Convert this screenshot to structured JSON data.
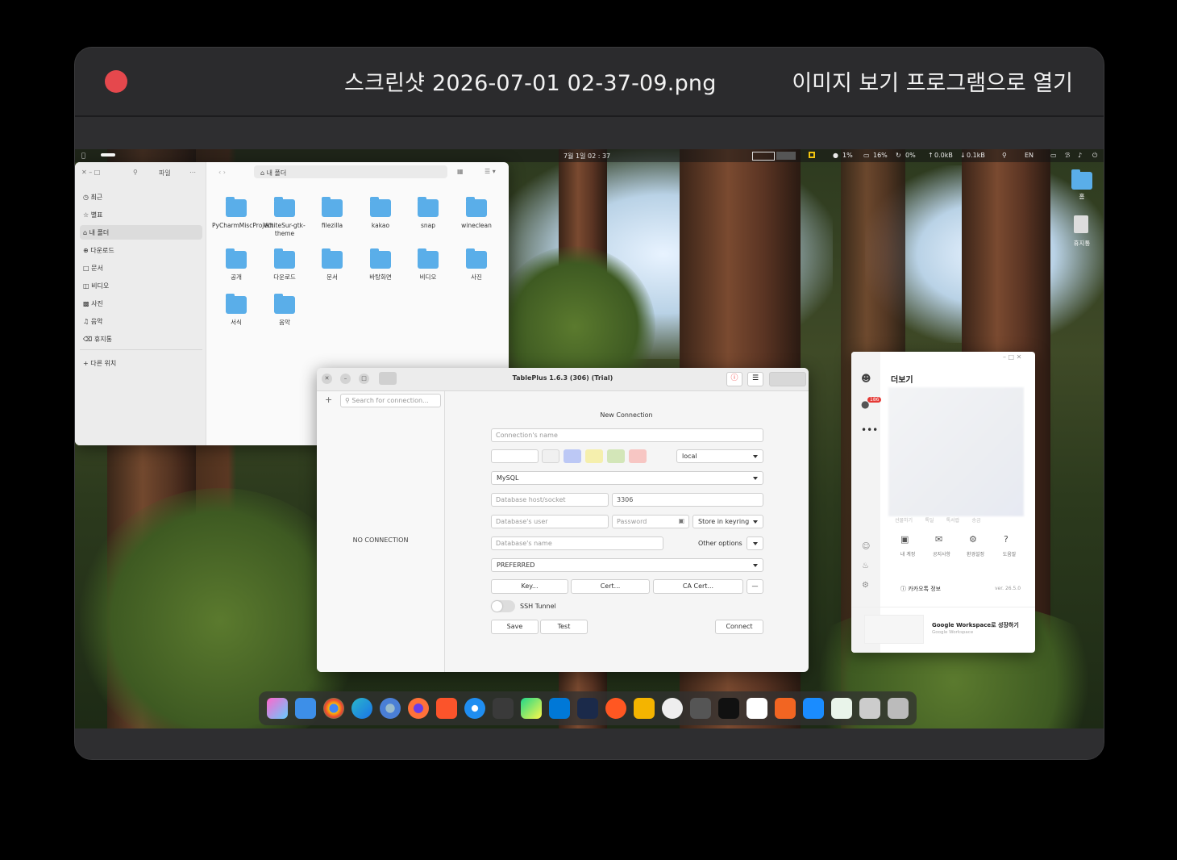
{
  "viewer": {
    "title": "스크린샷 2026-07-01 02-37-09.png",
    "open_with": "이미지 보기 프로그램으로 열기"
  },
  "topbar": {
    "clock": "7월 1일  02 : 37",
    "cpu": "1%",
    "battery": "16%",
    "net": "0%",
    "upload": "0.0kB",
    "download": "0.1kB",
    "lang": "EN"
  },
  "desktop": {
    "home_label": "홈",
    "trash_label": "휴지통"
  },
  "files": {
    "title": "파일",
    "path": "내 폴더",
    "sidebar": [
      "최근",
      "별표",
      "내 폴더",
      "다운로드",
      "문서",
      "비디오",
      "사진",
      "음악",
      "휴지통",
      "다른 위치"
    ],
    "folders": [
      "PyCharmMiscProject",
      "WhiteSur-gtk-theme",
      "filezilla",
      "kakao",
      "snap",
      "wineclean",
      "공개",
      "다운로드",
      "문서",
      "바탕화면",
      "비디오",
      "사진",
      "서식",
      "음악"
    ]
  },
  "tableplus": {
    "title": "TablePlus 1.6.3 (306) (Trial)",
    "search_placeholder": "Search for connection...",
    "no_connection": "NO CONNECTION",
    "heading": "New Connection",
    "name_placeholder": "Connection's name",
    "env": "local",
    "driver": "MySQL",
    "host_placeholder": "Database host/socket",
    "port": "3306",
    "user_placeholder": "Database's user",
    "password_placeholder": "Password",
    "keyring": "Store in keyring",
    "dbname_placeholder": "Database's name",
    "other_options": "Other options",
    "ssl": "PREFERRED",
    "key_btn": "Key...",
    "cert_btn": "Cert...",
    "ca_btn": "CA Cert...",
    "more_btn": "—",
    "ssh": "SSH Tunnel",
    "save": "Save",
    "test": "Test",
    "connect": "Connect",
    "colors": [
      "#f0f0f0",
      "#bcc8f5",
      "#f5efad",
      "#d3e6b8",
      "#f7c6c3"
    ]
  },
  "kakao": {
    "title": "더보기",
    "badge": "186",
    "faded_labels": "선물하기        톡딜        톡서랍        송금",
    "menu": [
      "내 계정",
      "공지사항",
      "환경설정",
      "도움말"
    ],
    "info": "카카오톡 정보",
    "version": "ver. 26.5.0",
    "ad_title": "Google Workspace로 성장하기",
    "ad_sub": "Google Workspace"
  }
}
